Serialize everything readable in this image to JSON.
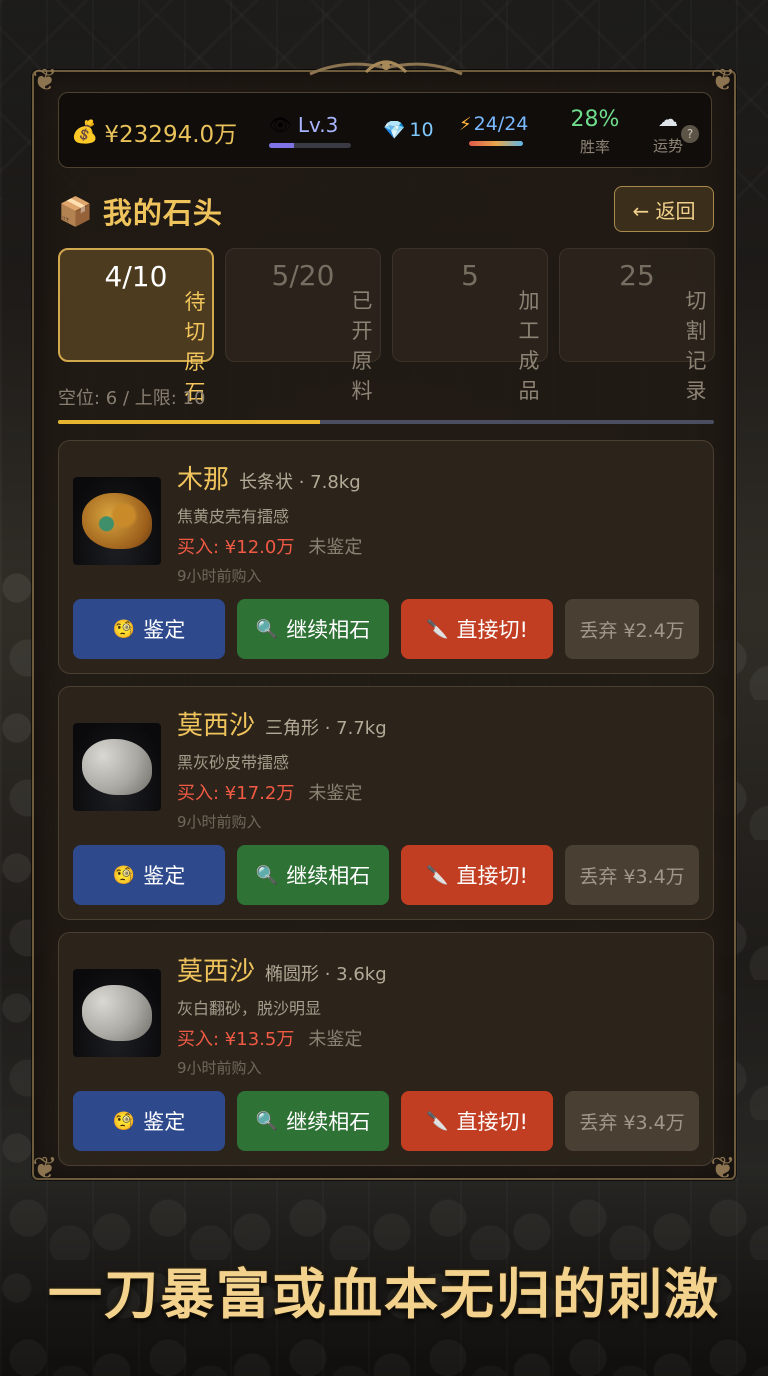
{
  "status": {
    "money": "¥23294.0万",
    "level": "Lv.3",
    "level_progress": 0.3,
    "gems": "10",
    "energy": "24/24",
    "win_rate": "28%",
    "win_rate_label": "胜率",
    "luck_label": "运势",
    "help": "?"
  },
  "header": {
    "title": "我的石头",
    "back_label": "← 返回"
  },
  "tabs": [
    {
      "label": "待切原石",
      "count": "4/10",
      "active": true
    },
    {
      "label": "已开原料",
      "count": "5/20",
      "active": false
    },
    {
      "label": "加工成品",
      "count": "5",
      "active": false
    },
    {
      "label": "切割记录",
      "count": "25",
      "active": false
    }
  ],
  "slots": {
    "text": "空位: 6 / 上限: 10",
    "fill_fraction": 0.4
  },
  "stones": [
    {
      "name": "木那",
      "meta": "长条状 · 7.8kg",
      "desc": "焦黄皮壳有擂感",
      "price": "买入: ¥12.0万",
      "status": "未鉴定",
      "time": "9小时前购入",
      "rock_color": "yellow",
      "actions": {
        "appraise": "鉴定",
        "inspect": "继续相石",
        "cut": "直接切!",
        "discard": "丢弃 ¥2.4万"
      }
    },
    {
      "name": "莫西沙",
      "meta": "三角形 · 7.7kg",
      "desc": "黑灰砂皮带擂感",
      "price": "买入: ¥17.2万",
      "status": "未鉴定",
      "time": "9小时前购入",
      "rock_color": "grey",
      "actions": {
        "appraise": "鉴定",
        "inspect": "继续相石",
        "cut": "直接切!",
        "discard": "丢弃 ¥3.4万"
      }
    },
    {
      "name": "莫西沙",
      "meta": "椭圆形 · 3.6kg",
      "desc": "灰白翻砂，脱沙明显",
      "price": "买入: ¥13.5万",
      "status": "未鉴定",
      "time": "9小时前购入",
      "rock_color": "grey",
      "actions": {
        "appraise": "鉴定",
        "inspect": "继续相石",
        "cut": "直接切!",
        "discard": "丢弃 ¥3.4万"
      }
    }
  ],
  "icons": {
    "money": "money-bag-icon",
    "level": "eye-icon",
    "gems": "diamond-icon",
    "energy": "lightning-icon",
    "luck": "cloud-icon",
    "header": "package-icon",
    "appraise": "monocle-face-icon",
    "inspect": "magnifier-icon",
    "cut": "knife-icon"
  },
  "slogan": "一刀暴富或血本无归的刺激"
}
